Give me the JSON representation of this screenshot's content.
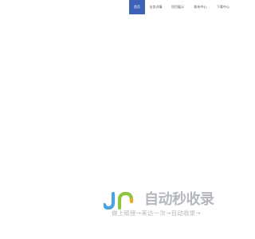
{
  "nav": {
    "items": [
      {
        "label": "首页",
        "active": true
      },
      {
        "label": "业务详情"
      },
      {
        "label": "项目展示"
      },
      {
        "label": "联系中心"
      },
      {
        "label": "下载中心"
      }
    ]
  },
  "brand": {
    "title": "自动秒收录",
    "slogan": "做上链接→来访一次→自动收录→",
    "colors": {
      "accent_blue": "#4aa3df",
      "accent_green": "#8cc63f",
      "accent_orange": "#f5a623",
      "text_gray": "#b4b8bd",
      "nav_active": "#3e63b6"
    }
  }
}
